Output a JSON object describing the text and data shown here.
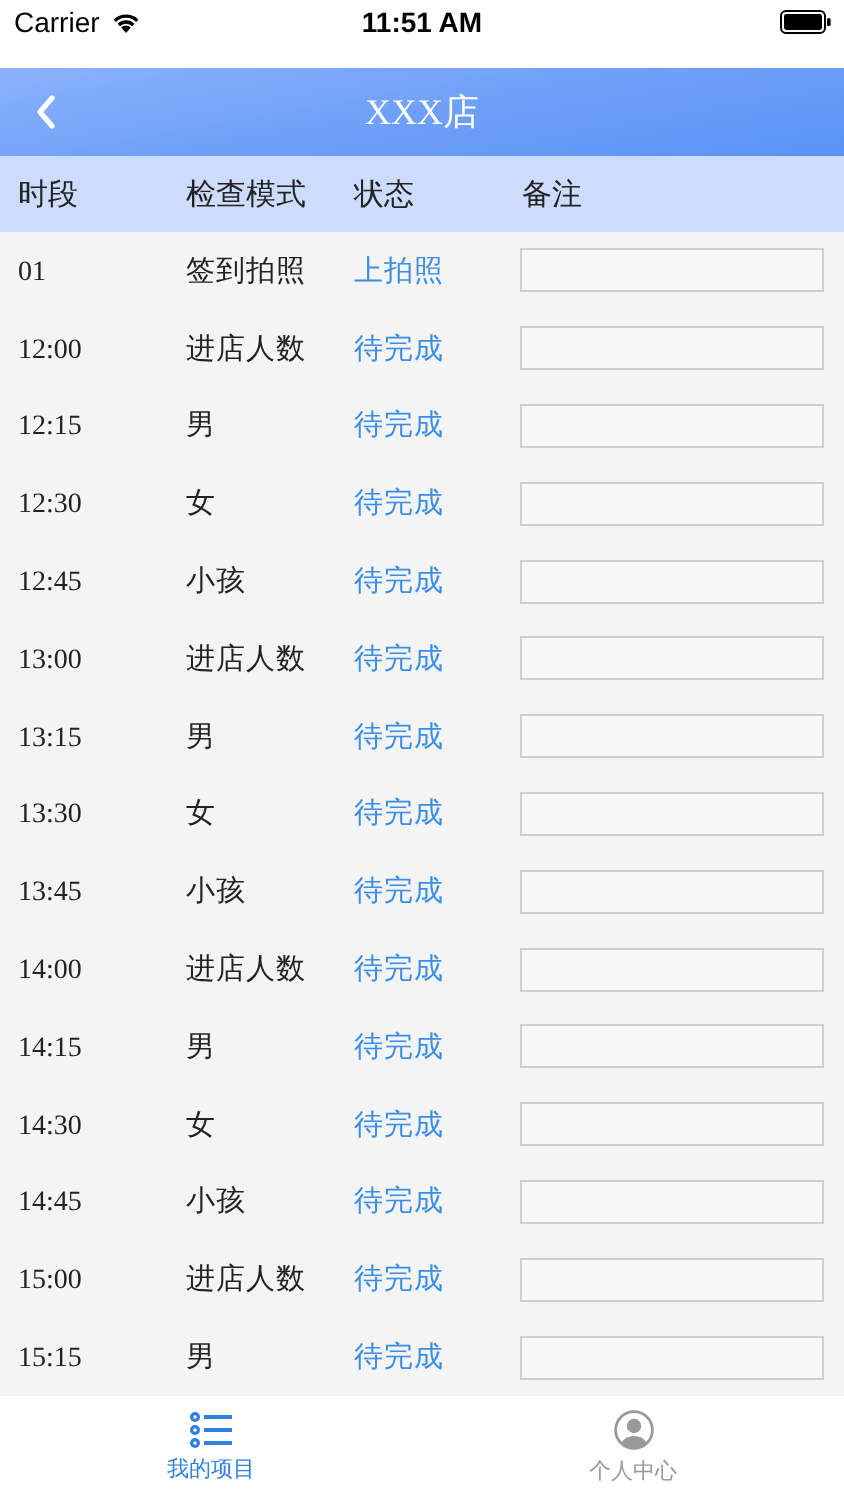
{
  "status_bar": {
    "carrier": "Carrier",
    "time": "11:51 AM"
  },
  "nav": {
    "title": "XXX店"
  },
  "table": {
    "columns": [
      "时段",
      "检查模式",
      "状态",
      "备注"
    ],
    "rows": [
      {
        "time": "01",
        "mode": "签到拍照",
        "status": "上拍照"
      },
      {
        "time": "12:00",
        "mode": "进店人数",
        "status": "待完成"
      },
      {
        "time": "12:15",
        "mode": "男",
        "status": "待完成"
      },
      {
        "time": "12:30",
        "mode": "女",
        "status": "待完成"
      },
      {
        "time": "12:45",
        "mode": "小孩",
        "status": "待完成"
      },
      {
        "time": "13:00",
        "mode": "进店人数",
        "status": "待完成"
      },
      {
        "time": "13:15",
        "mode": "男",
        "status": "待完成"
      },
      {
        "time": "13:30",
        "mode": "女",
        "status": "待完成"
      },
      {
        "time": "13:45",
        "mode": "小孩",
        "status": "待完成"
      },
      {
        "time": "14:00",
        "mode": "进店人数",
        "status": "待完成"
      },
      {
        "time": "14:15",
        "mode": "男",
        "status": "待完成"
      },
      {
        "time": "14:30",
        "mode": "女",
        "status": "待完成"
      },
      {
        "time": "14:45",
        "mode": "小孩",
        "status": "待完成"
      },
      {
        "time": "15:00",
        "mode": "进店人数",
        "status": "待完成"
      },
      {
        "time": "15:15",
        "mode": "男",
        "status": "待完成"
      }
    ]
  },
  "tab_bar": [
    {
      "label": "我的项目",
      "kind": "list",
      "selected": true
    },
    {
      "label": "个人中心",
      "kind": "person",
      "selected": false
    }
  ]
}
